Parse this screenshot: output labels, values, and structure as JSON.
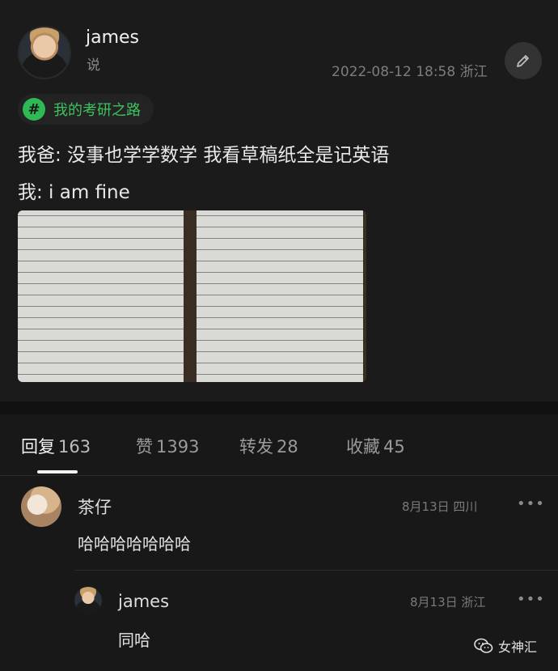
{
  "post": {
    "author": "james",
    "action": "说",
    "datetime": "2022-08-12 18:58",
    "location": "浙江",
    "topic": "我的考研之路",
    "line1": "我爸: 没事也学学数学 我看草稿纸全是记英语",
    "line2": "我: i am fine",
    "icons": {
      "edit": "pencil-icon",
      "topic": "hashtag-icon"
    }
  },
  "tabs": [
    {
      "label": "回复",
      "count": "163"
    },
    {
      "label": "赞",
      "count": "1393"
    },
    {
      "label": "转发",
      "count": "28"
    },
    {
      "label": "收藏",
      "count": "45"
    }
  ],
  "comments": [
    {
      "name": "茶仔",
      "date": "8月13日",
      "location": "四川",
      "text": "哈哈哈哈哈哈哈",
      "more": "•••"
    },
    {
      "name": "james",
      "date": "8月13日",
      "location": "浙江",
      "text": "同哈",
      "more": "•••"
    }
  ],
  "watermark": {
    "text": "女神汇"
  },
  "colors": {
    "accent_green": "#3cc35e",
    "background": "#181818"
  }
}
